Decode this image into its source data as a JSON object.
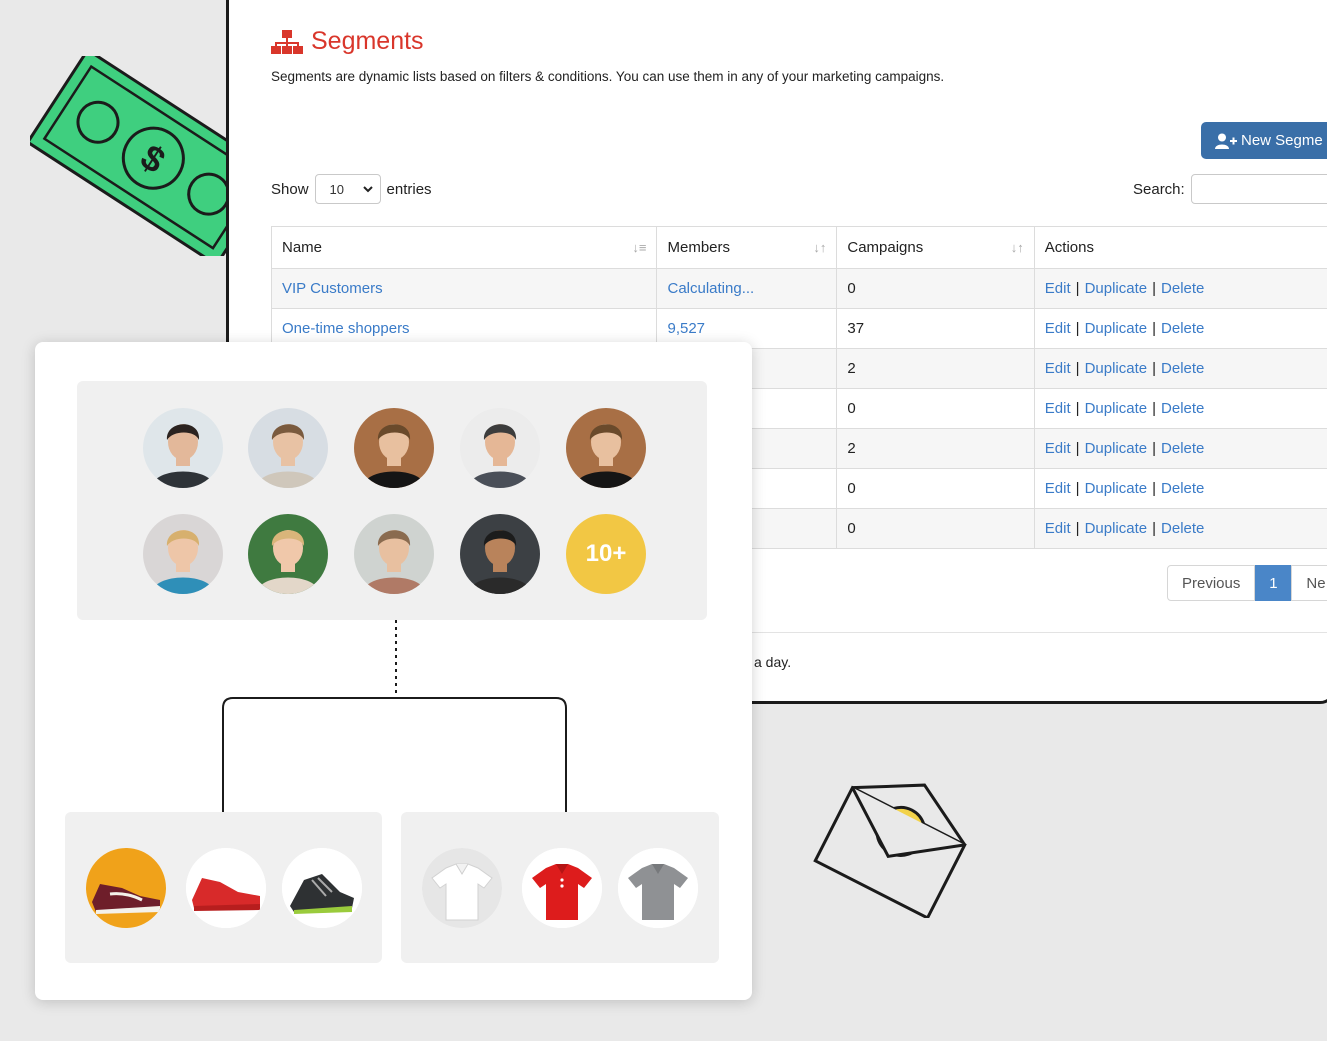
{
  "segments_page": {
    "title": "Segments",
    "description": "Segments are dynamic lists based on filters & conditions. You can use them in any of your marketing campaigns.",
    "new_button_label": "New Segme",
    "show_label": "Show",
    "entries_value": "10",
    "entries_label": "entries",
    "search_label": "Search:",
    "search_value": "",
    "columns": [
      "Name",
      "Members",
      "Campaigns",
      "Actions"
    ],
    "rows": [
      {
        "name": "VIP Customers",
        "members": "Calculating...",
        "campaigns": "0"
      },
      {
        "name": "One-time shoppers",
        "members": "9,527",
        "campaigns": "37"
      },
      {
        "name": "",
        "members": "",
        "campaigns": "2"
      },
      {
        "name": "",
        "members": "",
        "campaigns": "0"
      },
      {
        "name": "",
        "members": "",
        "campaigns": "2"
      },
      {
        "name": "",
        "members": "...",
        "campaigns": "0"
      },
      {
        "name": "",
        "members": "",
        "campaigns": "0"
      }
    ],
    "actions": {
      "edit": "Edit",
      "duplicate": "Duplicate",
      "delete": "Delete",
      "separator": "|"
    },
    "pagination": {
      "previous": "Previous",
      "current_page": "1",
      "next": "Ne"
    },
    "footer_text": "a day."
  },
  "audience_card": {
    "more_badge": "10+",
    "avatars": [
      "avatar-man-glasses",
      "avatar-woman-glasses",
      "avatar-young-man",
      "avatar-bald-man",
      "avatar-young-man",
      "avatar-woman-blonde",
      "avatar-woman-green-bg",
      "avatar-man-scarf",
      "avatar-man-smiling"
    ],
    "shoe_products": [
      "sneaker-burgundy-icon",
      "sneaker-red-icon",
      "sneaker-black-icon"
    ],
    "shirt_products": [
      "polo-white-icon",
      "polo-red-icon",
      "polo-grey-icon"
    ]
  },
  "colors": {
    "brand_red": "#d9362b",
    "link_blue": "#3a7bc8",
    "button_blue": "#3a6fa8",
    "badge_yellow": "#f2c744",
    "money_green": "#3fcf7f"
  }
}
